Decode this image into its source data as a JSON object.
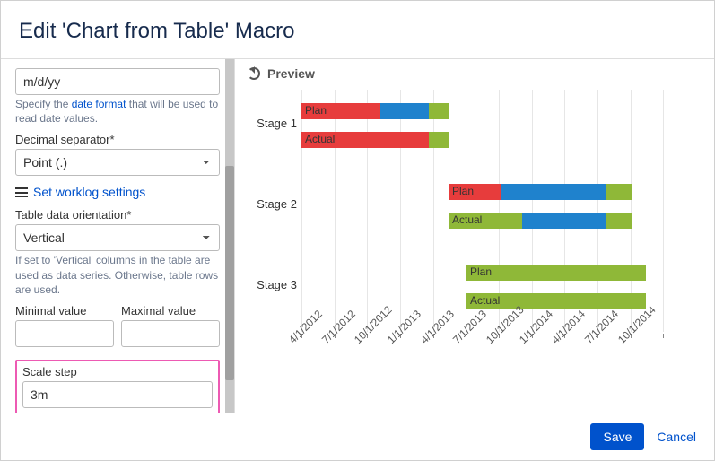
{
  "dialog": {
    "title": "Edit 'Chart from Table' Macro"
  },
  "form": {
    "date_fmt_value": "m/d/yy",
    "date_fmt_help_pre": "Specify the ",
    "date_fmt_help_link": "date format",
    "date_fmt_help_post": " that will be used to read date values.",
    "dec_sep_label": "Decimal separator*",
    "dec_sep_value": "Point (.)",
    "worklog_label": "Set worklog settings",
    "orientation_label": "Table data orientation*",
    "orientation_value": "Vertical",
    "orientation_help": "If set to 'Vertical' columns in the table are used as data series. Otherwise, table rows are used.",
    "min_label": "Minimal value",
    "max_label": "Maximal value",
    "min_value": "",
    "max_value": "",
    "scale_step_label": "Scale step",
    "scale_step_value": "3m"
  },
  "preview": {
    "label": "Preview"
  },
  "chart_data": {
    "type": "gantt",
    "x_axis": [
      "4/1/2012",
      "7/1/2012",
      "10/1/2012",
      "1/1/2013",
      "4/1/2013",
      "7/1/2013",
      "10/1/2013",
      "1/1/2014",
      "4/1/2014",
      "7/1/2014",
      "10/1/2014"
    ],
    "categories": [
      "Stage 1",
      "Stage 2",
      "Stage 3"
    ],
    "rows": [
      {
        "stage": "Stage 1",
        "label": "Plan",
        "segments": [
          {
            "start": 0,
            "end": 2.2,
            "color": "red"
          },
          {
            "start": 2.2,
            "end": 3.55,
            "color": "blue"
          },
          {
            "start": 3.55,
            "end": 4.1,
            "color": "green"
          }
        ]
      },
      {
        "stage": "Stage 1",
        "label": "Actual",
        "segments": [
          {
            "start": 0,
            "end": 3.55,
            "color": "red"
          },
          {
            "start": 3.55,
            "end": 4.1,
            "color": "green"
          }
        ]
      },
      {
        "stage": "Stage 2",
        "label": "Plan",
        "segments": [
          {
            "start": 4.1,
            "end": 5.55,
            "color": "red"
          },
          {
            "start": 5.55,
            "end": 8.5,
            "color": "blue"
          },
          {
            "start": 8.5,
            "end": 9.2,
            "color": "green"
          }
        ]
      },
      {
        "stage": "Stage 2",
        "label": "Actual",
        "segments": [
          {
            "start": 4.1,
            "end": 6.15,
            "color": "green"
          },
          {
            "start": 6.15,
            "end": 8.5,
            "color": "blue"
          },
          {
            "start": 8.5,
            "end": 9.2,
            "color": "green"
          }
        ]
      },
      {
        "stage": "Stage 3",
        "label": "Plan",
        "segments": [
          {
            "start": 4.6,
            "end": 9.6,
            "color": "green"
          }
        ]
      },
      {
        "stage": "Stage 3",
        "label": "Actual",
        "segments": [
          {
            "start": 4.6,
            "end": 9.6,
            "color": "green"
          }
        ]
      }
    ]
  },
  "buttons": {
    "save": "Save",
    "cancel": "Cancel"
  }
}
